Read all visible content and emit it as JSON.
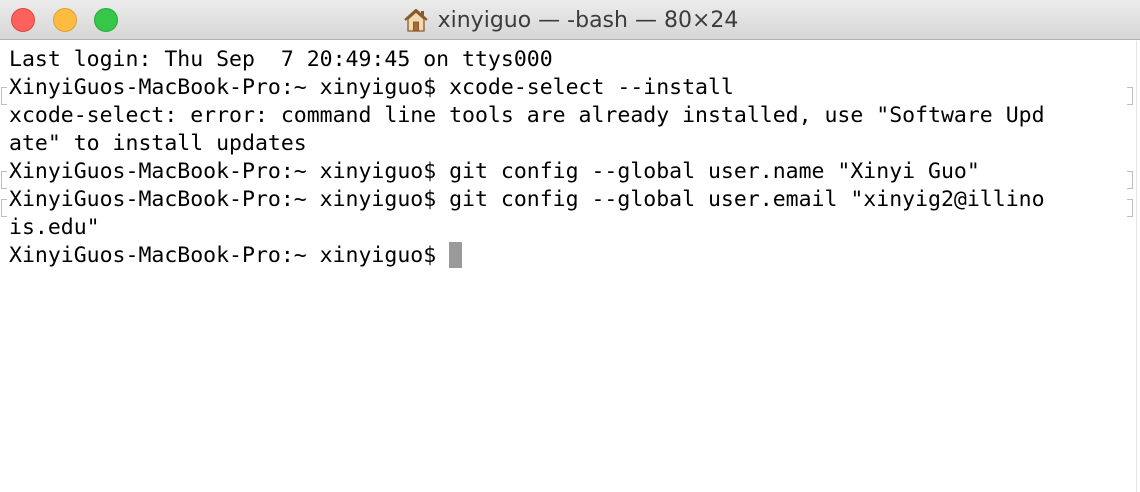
{
  "window": {
    "title": "xinyiguo — -bash — 80×24"
  },
  "terminal": {
    "lines": [
      "Last login: Thu Sep  7 20:49:45 on ttys000",
      "XinyiGuos-MacBook-Pro:~ xinyiguo$ xcode-select --install",
      "xcode-select: error: command line tools are already installed, use \"Software Upd",
      "ate\" to install updates",
      "XinyiGuos-MacBook-Pro:~ xinyiguo$ git config --global user.name \"Xinyi Guo\"",
      "XinyiGuos-MacBook-Pro:~ xinyiguo$ git config --global user.email \"xinyig2@illino",
      "is.edu\"",
      "XinyiGuos-MacBook-Pro:~ xinyiguo$"
    ]
  },
  "colors": {
    "close": "#fc615d",
    "minimize": "#fdbc40",
    "maximize": "#34c749",
    "cursor": "#9a9a9a",
    "text": "#000000",
    "background": "#ffffff"
  },
  "icons": {
    "title": "home-icon"
  }
}
